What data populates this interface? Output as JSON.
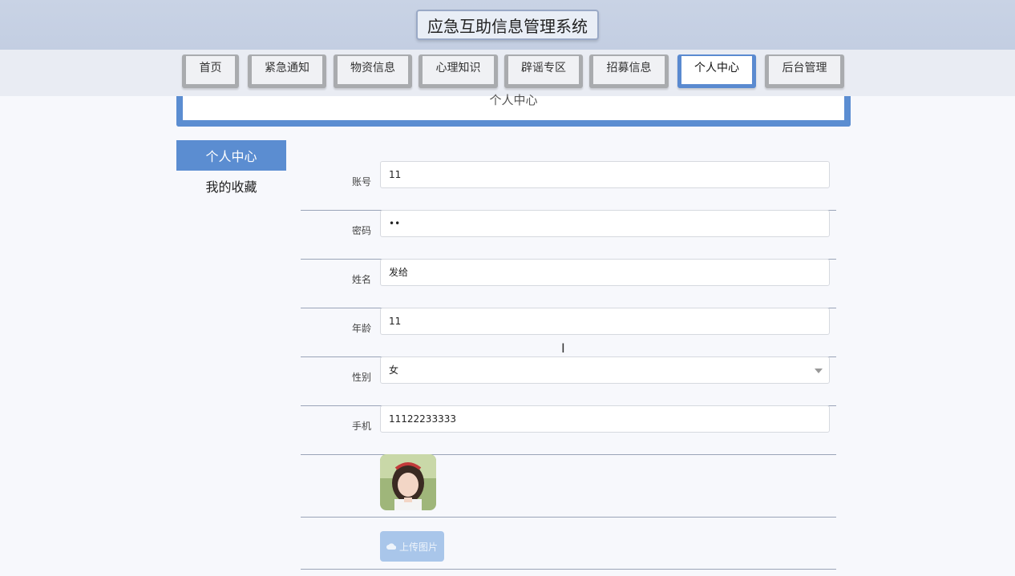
{
  "app": {
    "title": "应急互助信息管理系统"
  },
  "nav": {
    "items": [
      {
        "label": "首页"
      },
      {
        "label": "紧急通知"
      },
      {
        "label": "物资信息"
      },
      {
        "label": "心理知识"
      },
      {
        "label": "辟谣专区"
      },
      {
        "label": "招募信息"
      },
      {
        "label": "个人中心"
      },
      {
        "label": "后台管理"
      }
    ],
    "active": "个人中心"
  },
  "banner": {
    "title": "个人中心"
  },
  "sidebar": {
    "items": [
      {
        "label": "个人中心"
      },
      {
        "label": "我的收藏"
      }
    ]
  },
  "form": {
    "account": {
      "label": "账号",
      "value": "11"
    },
    "password": {
      "label": "密码",
      "value": "••"
    },
    "name": {
      "label": "姓名",
      "value": "发给"
    },
    "age": {
      "label": "年龄",
      "value": "11"
    },
    "gender": {
      "label": "性别",
      "value": "女"
    },
    "phone": {
      "label": "手机",
      "value": "11122233333"
    },
    "upload": {
      "label": "上传图片"
    }
  },
  "colors": {
    "accent": "#5b8dd1",
    "upload_button": "#a9c6ea"
  }
}
